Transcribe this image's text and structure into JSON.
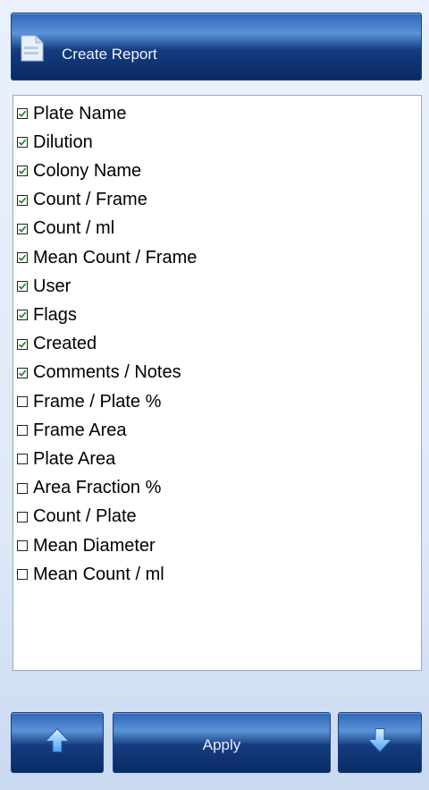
{
  "header": {
    "title": "Create Report",
    "icon": "document-icon"
  },
  "report_fields": [
    {
      "label": "Plate Name",
      "checked": true
    },
    {
      "label": "Dilution",
      "checked": true
    },
    {
      "label": "Colony Name",
      "checked": true
    },
    {
      "label": "Count / Frame",
      "checked": true
    },
    {
      "label": "Count / ml",
      "checked": true
    },
    {
      "label": "Mean Count / Frame",
      "checked": true
    },
    {
      "label": "User",
      "checked": true
    },
    {
      "label": "Flags",
      "checked": true
    },
    {
      "label": "Created",
      "checked": true
    },
    {
      "label": "Comments / Notes",
      "checked": true
    },
    {
      "label": "Frame / Plate %",
      "checked": false
    },
    {
      "label": "Frame Area",
      "checked": false
    },
    {
      "label": "Plate Area",
      "checked": false
    },
    {
      "label": "Area Fraction %",
      "checked": false
    },
    {
      "label": "Count / Plate",
      "checked": false
    },
    {
      "label": "Mean Diameter",
      "checked": false
    },
    {
      "label": "Mean Count / ml",
      "checked": false
    }
  ],
  "footer": {
    "up_icon": "arrow-up-icon",
    "apply_label": "Apply",
    "down_icon": "arrow-down-icon"
  },
  "colors": {
    "button_dark": "#0a2a64",
    "button_light": "#5a93d8",
    "check_green": "#2c8a2c"
  }
}
